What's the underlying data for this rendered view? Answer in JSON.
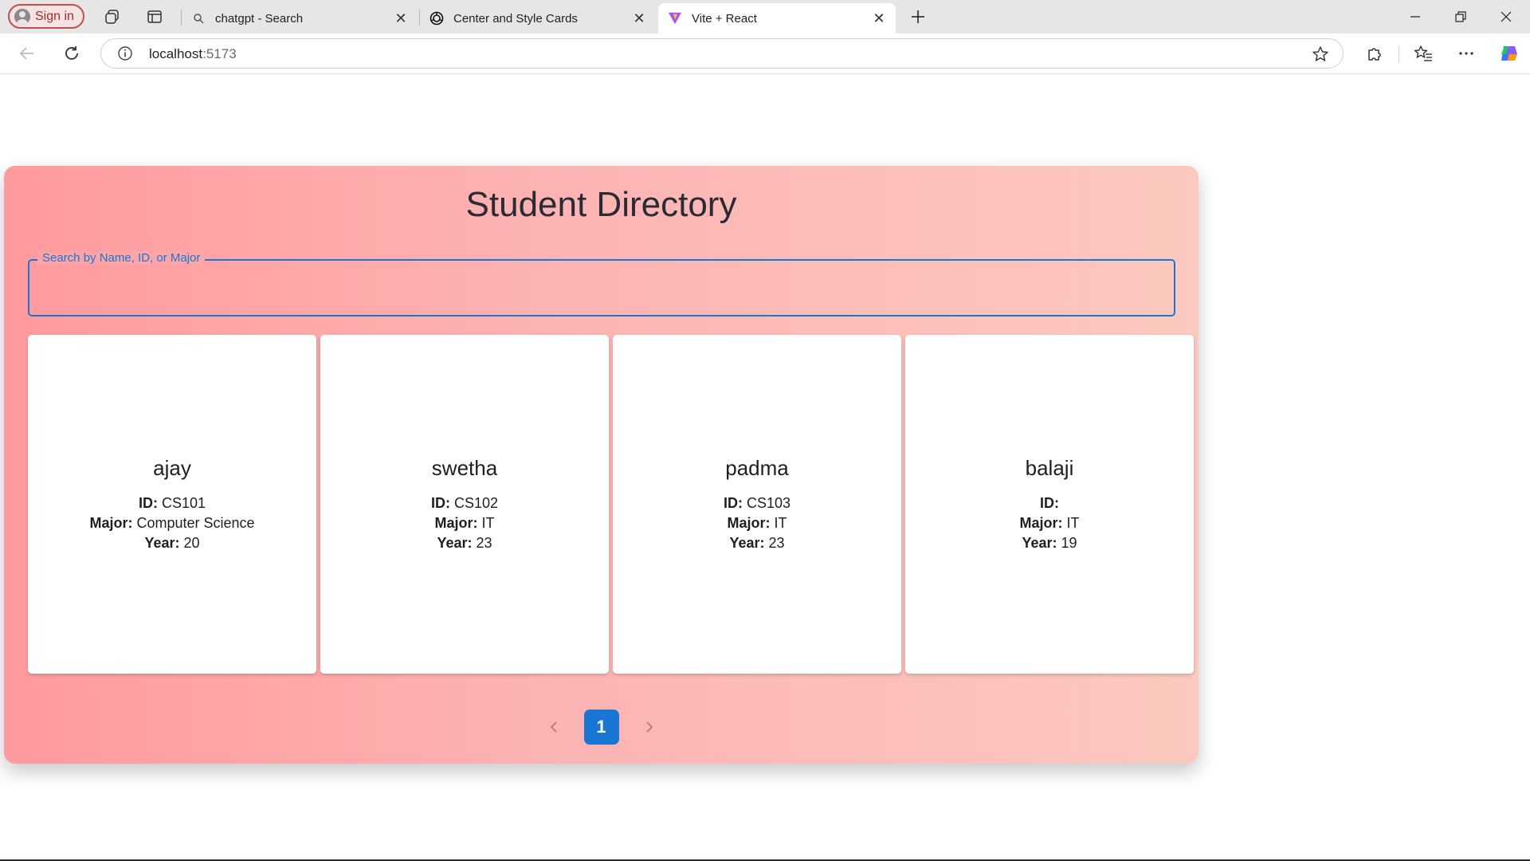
{
  "browser": {
    "signin_label": "Sign in",
    "tabs": [
      {
        "title": "chatgpt - Search",
        "icon": "search-favicon",
        "active": false
      },
      {
        "title": "Center and Style Cards",
        "icon": "openai-favicon",
        "active": false
      },
      {
        "title": "Vite + React",
        "icon": "vite-favicon",
        "active": true
      }
    ],
    "address": {
      "host": "localhost",
      "port": ":5173"
    }
  },
  "page": {
    "title": "Student Directory",
    "search": {
      "label": "Search by Name, ID, or Major",
      "value": ""
    },
    "field_labels": {
      "id": "ID:",
      "major": "Major:",
      "year": "Year:"
    },
    "students": [
      {
        "name": "ajay",
        "id": "CS101",
        "major": "Computer Science",
        "year": "20"
      },
      {
        "name": "swetha",
        "id": "CS102",
        "major": "IT",
        "year": "23"
      },
      {
        "name": "padma",
        "id": "CS103",
        "major": "IT",
        "year": "23"
      },
      {
        "name": "balaji",
        "id": "",
        "major": "IT",
        "year": "19"
      }
    ],
    "pagination": {
      "current": "1"
    }
  },
  "colors": {
    "accent": "#1976d2",
    "gradient_start": "#ff9a9e",
    "gradient_end": "#fbc9bf"
  }
}
